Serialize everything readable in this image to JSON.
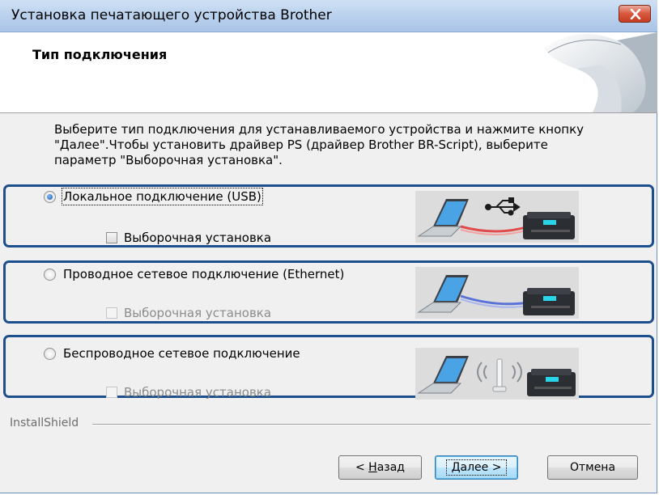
{
  "window": {
    "title": "Установка печатающего устройства Brother",
    "close_icon": "close-icon"
  },
  "banner": {
    "title": "Тип подключения"
  },
  "intro": {
    "line1": "Выберите тип подключения для устанавливаемого устройства и нажмите кнопку",
    "line2": "\"Далее\".Чтобы установить драйвер PS (драйвер Brother BR-Script), выберите",
    "line3": "параметр \"Выборочная установка\"."
  },
  "options": [
    {
      "label": "Локальное подключение (USB)",
      "selected": true,
      "custom_label": "Выборочная установка",
      "custom_enabled": true,
      "custom_checked": false
    },
    {
      "label": "Проводное сетевое подключение (Ethernet)",
      "selected": false,
      "custom_label": "Выборочная установка",
      "custom_enabled": false,
      "custom_checked": false
    },
    {
      "label": "Беспроводное сетевое подключение",
      "selected": false,
      "custom_label": "Выборочная установка",
      "custom_enabled": false,
      "custom_checked": false
    }
  ],
  "footer": {
    "brand": "InstallShield",
    "back_prefix": "< ",
    "back_hotkey": "Н",
    "back_rest": "азад",
    "next_label": "Далее >",
    "cancel_label": "Отмена"
  },
  "colors": {
    "group_border": "#1c4f8c",
    "usb_cable": "#e24b4b",
    "ethernet_cable": "#5b73d8"
  }
}
